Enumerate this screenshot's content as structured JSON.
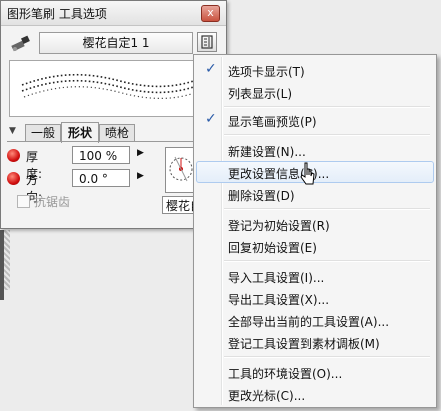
{
  "panel": {
    "title": "图形笔刷 工具选项",
    "close_glyph": "x",
    "preset_name": "樱花自定1 1",
    "tabs": [
      {
        "label": "一般"
      },
      {
        "label": "形状"
      },
      {
        "label": "喷枪"
      }
    ],
    "params": {
      "thickness": {
        "label": "厚度:",
        "value": "100 %"
      },
      "direction": {
        "label": "方向:",
        "value": "0.0 °"
      }
    },
    "antialias": {
      "label": "抗锯齿",
      "checked": false
    },
    "brush_name": "樱花自定",
    "icons": {
      "brush": "brush-icon",
      "menu": "panel-menu-icon",
      "dial": "angle-dial-icon"
    }
  },
  "menu": {
    "items": [
      {
        "label": "选项卡显示(T)",
        "checked": true
      },
      {
        "label": "列表显示(L)",
        "checked": false
      },
      {
        "label": "显示笔画预览(P)",
        "checked": true
      },
      {
        "label": "新建设置(N)...",
        "checked": false
      },
      {
        "label": "更改设置信息(C)...",
        "checked": false,
        "hover": true
      },
      {
        "label": "删除设置(D)",
        "checked": false
      },
      {
        "label": "登记为初始设置(R)",
        "checked": false
      },
      {
        "label": "回复初始设置(E)",
        "checked": false
      },
      {
        "label": "导入工具设置(I)...",
        "checked": false
      },
      {
        "label": "导出工具设置(X)...",
        "checked": false
      },
      {
        "label": "全部导出当前的工具设置(A)...",
        "checked": false
      },
      {
        "label": "登记工具设置到素材调板(M)",
        "checked": false
      },
      {
        "label": "工具的环境设置(O)...",
        "checked": false
      },
      {
        "label": "更改光标(C)...",
        "checked": false
      }
    ],
    "check_glyph": "✓",
    "accent_color": "#2a5ba8"
  }
}
